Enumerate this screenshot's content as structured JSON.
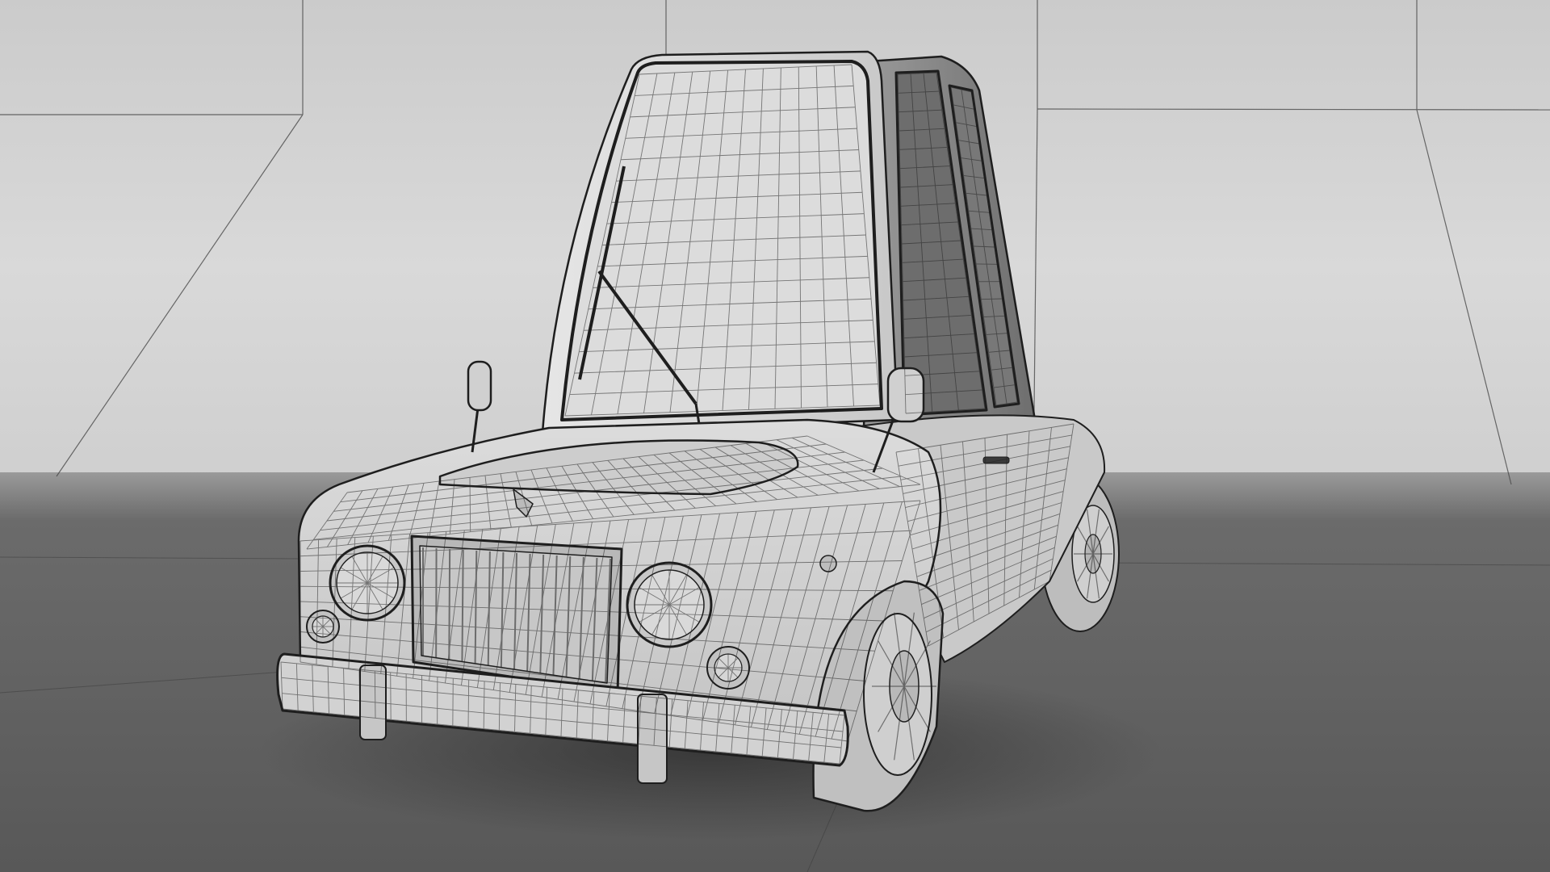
{
  "scene": {
    "subject": "cartoon-car-wireframe-model",
    "background_color": "#d3d3d3",
    "floor_color": "#5b5b5b",
    "mesh_line_color": "#1e1e1e",
    "model_base_color": "#d6d6d6"
  }
}
